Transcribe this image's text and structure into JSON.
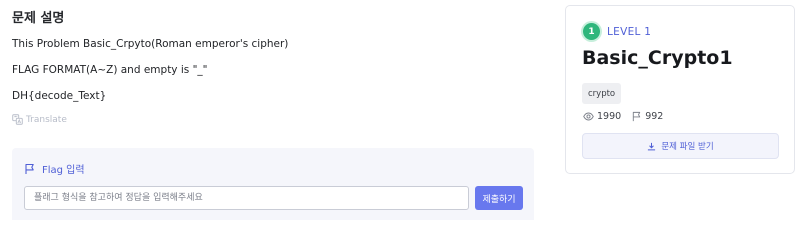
{
  "description": {
    "section_title": "문제 설명",
    "lines": [
      "This Problem Basic_Crpyto(Roman emperor's cipher)",
      "FLAG FORMAT(A~Z) and empty is \"_\"",
      "DH{decode_Text}"
    ],
    "translate_label": "Translate"
  },
  "flag": {
    "header_label": "Flag 입력",
    "input_value": "",
    "input_placeholder": "플래그 형식을 참고하여 정답을 입력해주세요",
    "submit_label": "제출하기"
  },
  "card": {
    "level_number": "1",
    "level_label": "LEVEL 1",
    "title": "Basic_Crypto1",
    "tag": "crypto",
    "views": "1990",
    "solves": "992",
    "download_label": "문제 파일 받기"
  },
  "colors": {
    "accent": "#4f5fd6",
    "submit_button": "#6878ee",
    "level_badge": "#2fb67c",
    "flag_panel_bg": "#f5f6fb"
  },
  "icons": {
    "translate": "translate-icon",
    "flag": "flag-icon",
    "views": "eye-icon",
    "solves": "flag-outline-icon",
    "download": "download-icon"
  }
}
